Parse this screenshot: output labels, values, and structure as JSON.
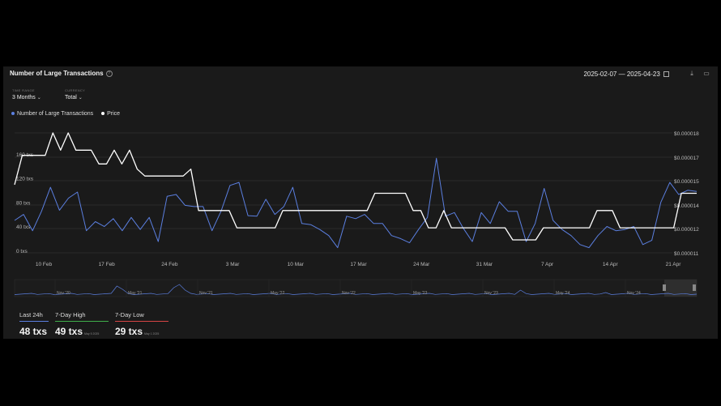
{
  "header": {
    "title": "Number of Large Transactions",
    "date_start": "2025-02-07",
    "date_sep": "—",
    "date_end": "2025-04-23"
  },
  "controls": {
    "timeframe": {
      "label": "TIME RANGE",
      "value": "3 Months"
    },
    "aggregation": {
      "label": "CURRENCY",
      "value": "Total"
    }
  },
  "legend": {
    "series1": "Number of Large Transactions",
    "series2": "Price"
  },
  "colors": {
    "transactions": "#5b7fe0",
    "price": "#ffffff",
    "grid": "#3a3a3a",
    "high": "#3fae4a",
    "low": "#d64545",
    "last": "#5b7fe0"
  },
  "chart_data": {
    "type": "line",
    "y_left_ticks": [
      "0 txs",
      "40 txs",
      "80 txs",
      "120 txs",
      "160 txs"
    ],
    "y_right_ticks": [
      "$0.000011",
      "$0.000012",
      "$0.000014",
      "$0.000015",
      "$0.000017",
      "$0.000018"
    ],
    "x_ticks": [
      "10 Feb",
      "17 Feb",
      "24 Feb",
      "3 Mar",
      "10 Mar",
      "17 Mar",
      "24 Mar",
      "31 Mar",
      "7 Apr",
      "14 Apr",
      "21 Apr"
    ],
    "ylim_left": [
      0,
      200
    ],
    "ylim_right": [
      1.1e-05,
      1.8e-05
    ],
    "series": [
      {
        "name": "Number of Large Transactions",
        "axis": "left",
        "values": [
          55,
          65,
          38,
          70,
          110,
          72,
          92,
          102,
          38,
          53,
          45,
          58,
          38,
          60,
          40,
          60,
          20,
          95,
          98,
          80,
          78,
          78,
          38,
          70,
          113,
          118,
          63,
          62,
          90,
          65,
          78,
          110,
          50,
          48,
          40,
          30,
          10,
          62,
          58,
          65,
          50,
          50,
          30,
          25,
          18,
          40,
          60,
          158,
          62,
          68,
          42,
          20,
          68,
          50,
          86,
          70,
          70,
          20,
          50,
          108,
          55,
          40,
          30,
          15,
          10,
          30,
          45,
          38,
          40,
          45,
          15,
          22,
          85,
          118,
          98,
          105,
          103
        ],
        "color": "#5b7fe0"
      },
      {
        "name": "Price",
        "axis": "right",
        "values": [
          1.5e-05,
          1.67e-05,
          1.67e-05,
          1.67e-05,
          1.67e-05,
          1.8e-05,
          1.7e-05,
          1.8e-05,
          1.7e-05,
          1.7e-05,
          1.7e-05,
          1.62e-05,
          1.62e-05,
          1.7e-05,
          1.62e-05,
          1.7e-05,
          1.59e-05,
          1.55e-05,
          1.55e-05,
          1.55e-05,
          1.55e-05,
          1.55e-05,
          1.55e-05,
          1.59e-05,
          1.35e-05,
          1.35e-05,
          1.35e-05,
          1.35e-05,
          1.35e-05,
          1.25e-05,
          1.25e-05,
          1.25e-05,
          1.25e-05,
          1.25e-05,
          1.25e-05,
          1.35e-05,
          1.35e-05,
          1.35e-05,
          1.35e-05,
          1.35e-05,
          1.35e-05,
          1.35e-05,
          1.35e-05,
          1.35e-05,
          1.35e-05,
          1.35e-05,
          1.35e-05,
          1.45e-05,
          1.45e-05,
          1.45e-05,
          1.45e-05,
          1.45e-05,
          1.35e-05,
          1.35e-05,
          1.25e-05,
          1.25e-05,
          1.35e-05,
          1.25e-05,
          1.25e-05,
          1.25e-05,
          1.25e-05,
          1.25e-05,
          1.25e-05,
          1.25e-05,
          1.25e-05,
          1.18e-05,
          1.18e-05,
          1.18e-05,
          1.18e-05,
          1.25e-05,
          1.25e-05,
          1.25e-05,
          1.25e-05,
          1.25e-05,
          1.25e-05,
          1.25e-05,
          1.35e-05,
          1.35e-05,
          1.35e-05,
          1.25e-05,
          1.25e-05,
          1.25e-05,
          1.25e-05,
          1.25e-05,
          1.25e-05,
          1.25e-05,
          1.25e-05,
          1.45e-05,
          1.45e-05,
          1.45e-05
        ],
        "color": "#ffffff"
      }
    ]
  },
  "navigator": {
    "labels": [
      "Nov '20",
      "May '21",
      "Nov '21",
      "May '22",
      "Nov '22",
      "May '23",
      "Nov '23",
      "May '24",
      "Nov '24"
    ]
  },
  "stats": [
    {
      "label": "Last 24h",
      "value": "48 txs",
      "sub": "",
      "color": "#5b7fe0"
    },
    {
      "label": "7-Day High",
      "value": "49 txs",
      "sub": "May 5 2025",
      "color": "#3fae4a"
    },
    {
      "label": "7-Day Low",
      "value": "29 txs",
      "sub": "May 1 2025",
      "color": "#d64545"
    }
  ]
}
